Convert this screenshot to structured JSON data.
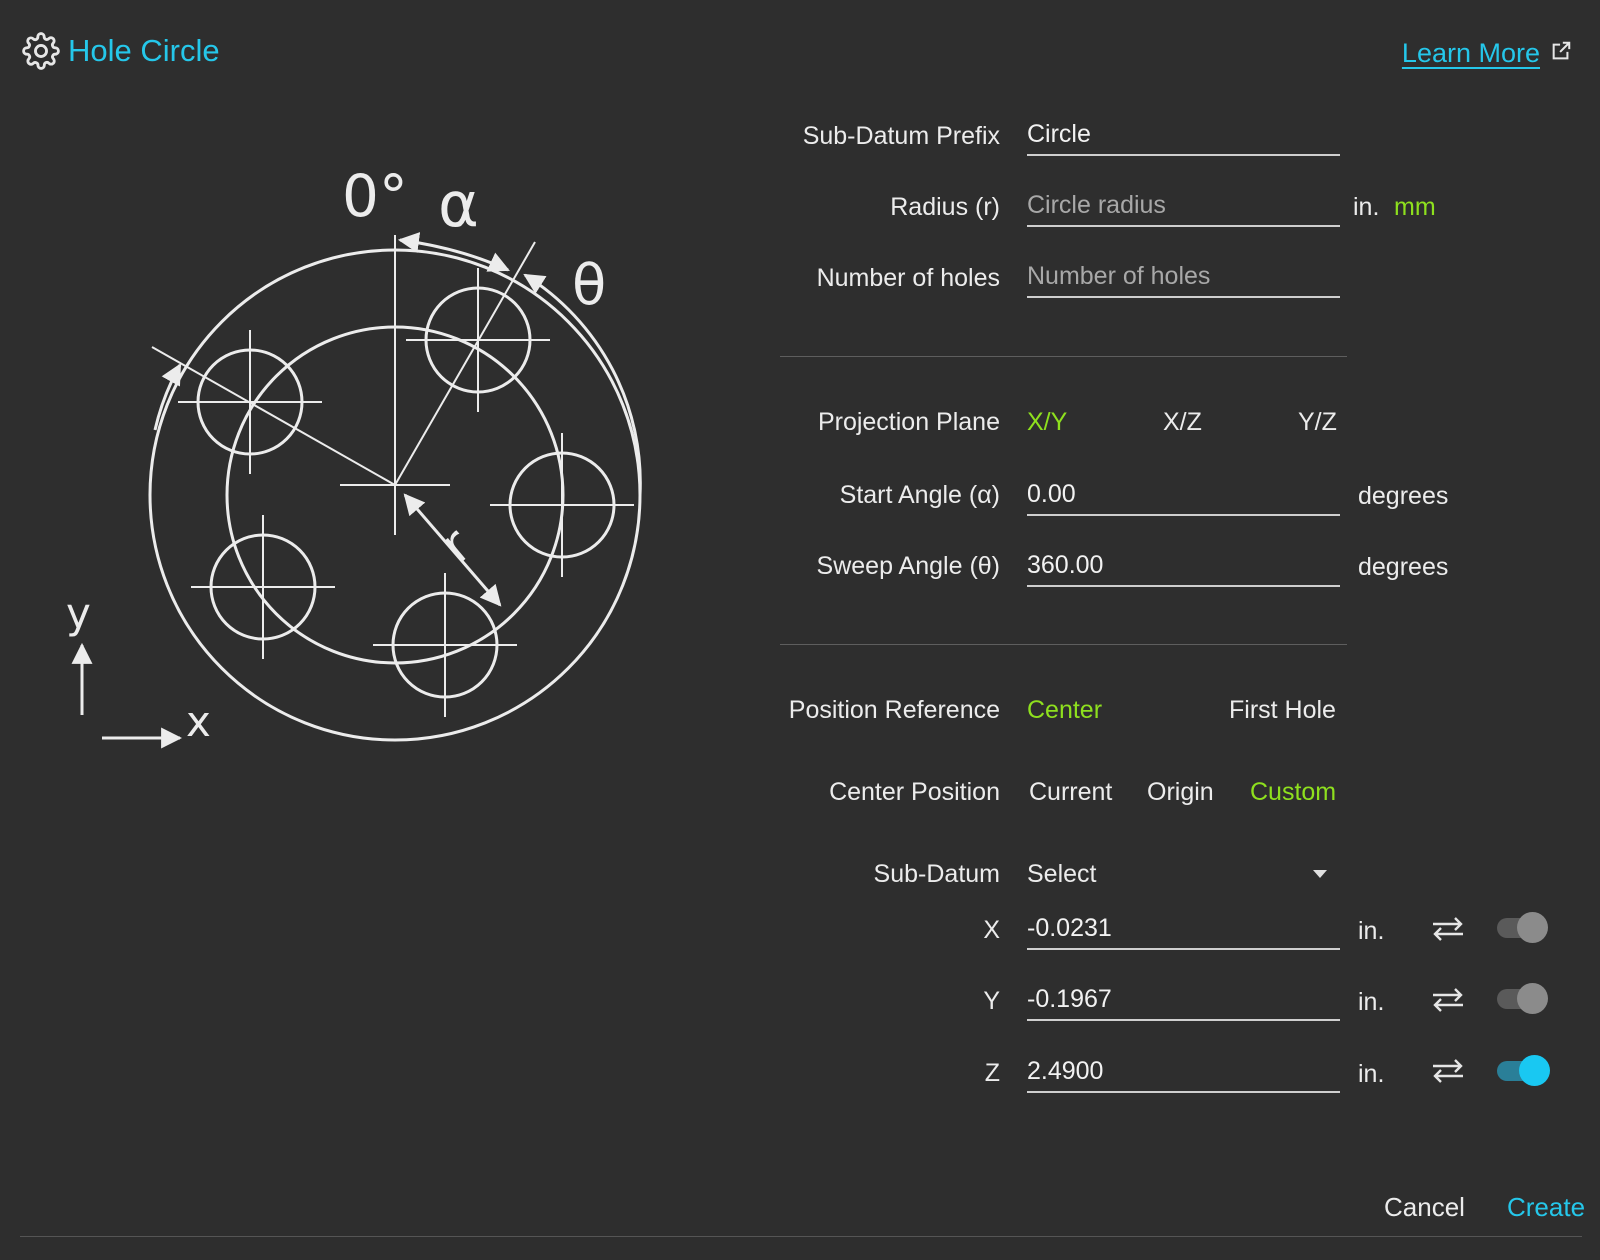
{
  "header": {
    "title": "Hole Circle",
    "icon": "gear-icon",
    "learn_more": "Learn More",
    "external_icon": "external-link-icon"
  },
  "diagram": {
    "labels": {
      "zero": "0°",
      "alpha": "α",
      "theta": "θ",
      "r": "r",
      "x": "x",
      "y": "y"
    }
  },
  "form": {
    "sub_datum_prefix": {
      "label": "Sub-Datum Prefix",
      "value": "Circle"
    },
    "radius": {
      "label": "Radius (r)",
      "placeholder": "Circle radius",
      "unit_in": "in.",
      "unit_mm": "mm"
    },
    "holes": {
      "label": "Number of holes",
      "placeholder": "Number of holes"
    },
    "projection_plane": {
      "label": "Projection Plane",
      "options": [
        "X/Y",
        "X/Z",
        "Y/Z"
      ],
      "selected": "X/Y"
    },
    "start_angle": {
      "label": "Start Angle (α)",
      "value": "0.00",
      "unit": "degrees"
    },
    "sweep_angle": {
      "label": "Sweep Angle (θ)",
      "value": "360.00",
      "unit": "degrees"
    },
    "position_reference": {
      "label": "Position Reference",
      "options": [
        "Center",
        "First Hole"
      ],
      "selected": "Center"
    },
    "center_position": {
      "label": "Center Position",
      "options": [
        "Current",
        "Origin",
        "Custom"
      ],
      "selected": "Custom"
    },
    "sub_datum": {
      "label": "Sub-Datum",
      "value": "Select"
    },
    "coords": [
      {
        "axis": "X",
        "value": "-0.0231",
        "unit": "in.",
        "toggle_on": false
      },
      {
        "axis": "Y",
        "value": "-0.1967",
        "unit": "in.",
        "toggle_on": false
      },
      {
        "axis": "Z",
        "value": "2.4900",
        "unit": "in.",
        "toggle_on": true
      }
    ]
  },
  "footer": {
    "cancel": "Cancel",
    "create": "Create"
  },
  "colors": {
    "accent": "#25c7ea",
    "selected": "#8ee01e",
    "background": "#2e2e2e"
  }
}
